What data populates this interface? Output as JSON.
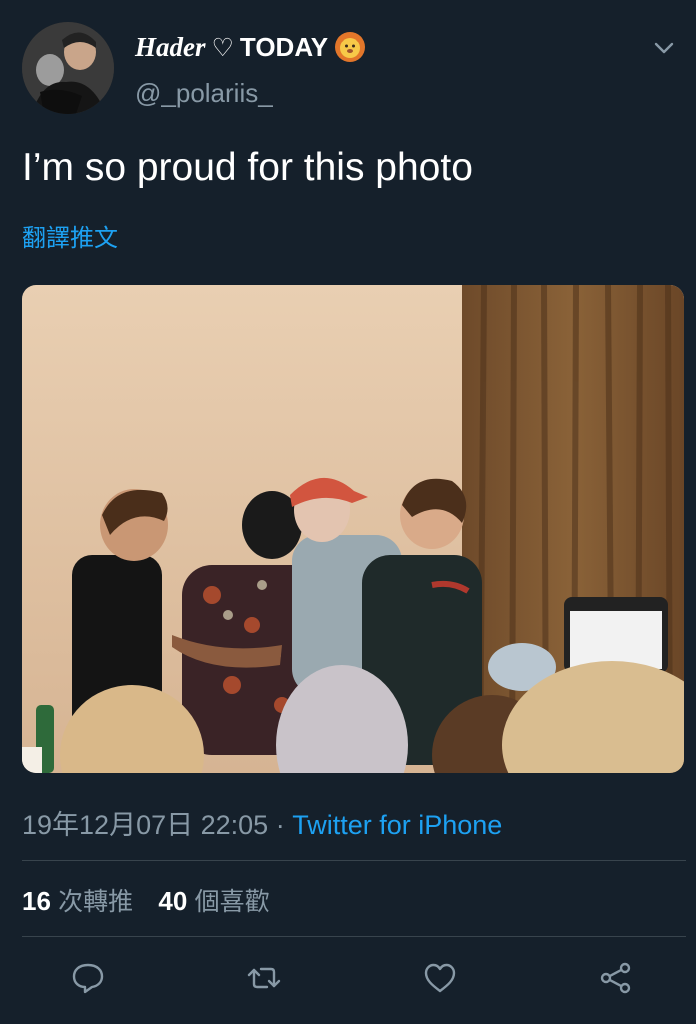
{
  "user": {
    "name_italic": "Hader",
    "name_heart": "♡",
    "name_bold": "TODAY",
    "name_emoji_icon": "lion-face-icon",
    "handle": "@_polariis_"
  },
  "tweet": {
    "text": "I’m so proud for this photo",
    "translate_label": "翻譯推文"
  },
  "meta": {
    "timestamp": "19年12月07日 22:05",
    "separator": "·",
    "source": "Twitter for iPhone"
  },
  "stats": {
    "retweets_count": "16",
    "retweets_label": "次轉推",
    "likes_count": "40",
    "likes_label": "個喜歡"
  },
  "actions": [
    "reply-icon",
    "retweet-icon",
    "like-icon",
    "share-icon"
  ],
  "colors": {
    "background": "#15202b",
    "accent": "#1da1f2",
    "secondary_text": "#8899a6",
    "divider": "#38444d"
  }
}
